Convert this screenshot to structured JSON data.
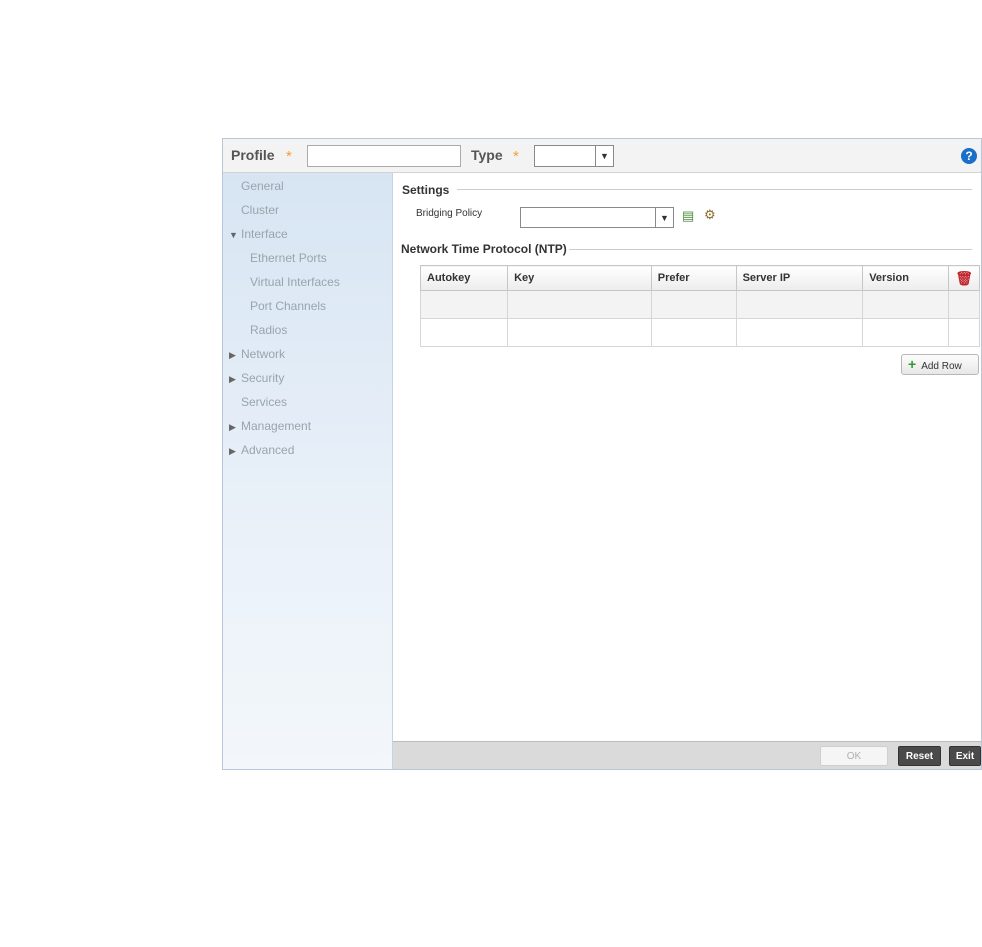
{
  "header": {
    "profile_label": "Profile",
    "profile_value": "",
    "type_label": "Type",
    "type_value": "",
    "required_mark": "*",
    "help_symbol": "?"
  },
  "sidebar": {
    "items": [
      {
        "label": "General",
        "expander": ""
      },
      {
        "label": "Cluster",
        "expander": ""
      },
      {
        "label": "Interface",
        "expander": "▼"
      },
      {
        "label": "Ethernet Ports",
        "expander": ""
      },
      {
        "label": "Virtual Interfaces",
        "expander": ""
      },
      {
        "label": "Port Channels",
        "expander": ""
      },
      {
        "label": "Radios",
        "expander": ""
      },
      {
        "label": "Network",
        "expander": "▶"
      },
      {
        "label": "Security",
        "expander": "▶"
      },
      {
        "label": "Services",
        "expander": ""
      },
      {
        "label": "Management",
        "expander": "▶"
      },
      {
        "label": "Advanced",
        "expander": "▶"
      }
    ]
  },
  "settings": {
    "title": "Settings",
    "bridging_policy_label": "Bridging Policy",
    "bridging_policy_value": "",
    "add_icon": "add-policy-icon",
    "config_icon": "gear-icon"
  },
  "ntp": {
    "title": "Network Time Protocol (NTP)",
    "columns": [
      "Autokey",
      "Key",
      "Prefer",
      "Server IP",
      "Version"
    ],
    "rows": [
      [
        "",
        "",
        "",
        "",
        ""
      ],
      [
        "",
        "",
        "",
        "",
        ""
      ]
    ],
    "add_row_label": "Add Row",
    "delete_icon": "trash-icon"
  },
  "footer": {
    "ok_label": "OK",
    "reset_label": "Reset",
    "exit_label": "Exit"
  },
  "colors": {
    "accent": "#1a6fc8",
    "required": "#f0a030",
    "delete": "#c0262c",
    "add": "#2e9a2e"
  }
}
